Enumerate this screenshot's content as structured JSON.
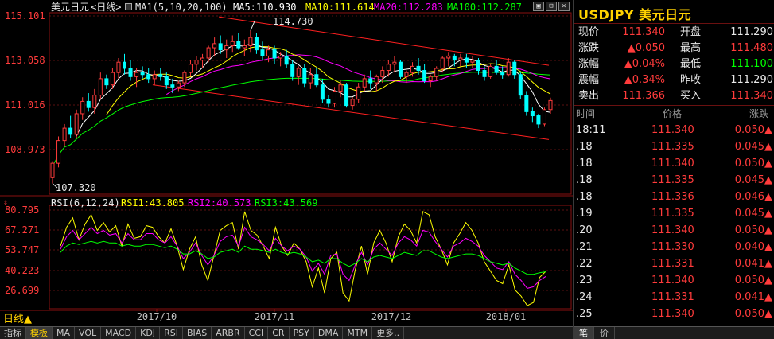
{
  "main_header": {
    "title": "美元日元",
    "period_tag": "<日线>",
    "ma_params": "MA1(5,10,20,100)",
    "ma5": "MA5:110.930",
    "ma10": "MA10:111.614",
    "ma20": "MA20:112.283",
    "ma100": "MA100:112.287"
  },
  "price_axis": {
    "ticks": [
      "115.101",
      "113.058",
      "111.016",
      "108.973"
    ]
  },
  "annotations": {
    "high": "114.730",
    "low": "107.320"
  },
  "rsi_header": {
    "params": "RSI(6,12,24)",
    "rsi1": "RSI1:43.805",
    "rsi2": "RSI2:40.573",
    "rsi3": "RSI3:43.569"
  },
  "rsi_axis": {
    "ticks": [
      "80.795",
      "67.271",
      "53.747",
      "40.223",
      "26.699"
    ]
  },
  "x_axis": {
    "labels": [
      "2017/10",
      "2017/11",
      "2017/12",
      "2018/01"
    ]
  },
  "period_label": "日线▲",
  "bottom_tabs": [
    "指标",
    "模板",
    "MA",
    "VOL",
    "MACD",
    "KDJ",
    "RSI",
    "BIAS",
    "ARBR",
    "CCI",
    "CR",
    "PSY",
    "DMA",
    "MTM",
    "更多.."
  ],
  "active_bottom_tab": "模板",
  "colors": {
    "up": "#ff3b3b",
    "down": "#00ffff",
    "ma5": "#ffffff",
    "ma10": "#ffff00",
    "ma20": "#ff00ff",
    "ma100": "#00ff00",
    "channel": "#ff2020"
  },
  "quote": {
    "symbol_title": "USDJPY 美元日元",
    "rows": [
      {
        "l1": "现价",
        "v1": "111.340",
        "c1": "red",
        "l2": "开盘",
        "v2": "111.290",
        "c2": "wht"
      },
      {
        "l1": "涨跌",
        "v1": "▲0.050",
        "c1": "red",
        "l2": "最高",
        "v2": "111.480",
        "c2": "red"
      },
      {
        "l1": "涨幅",
        "v1": "▲0.04%",
        "c1": "red",
        "l2": "最低",
        "v2": "111.100",
        "c2": "grn"
      },
      {
        "l1": "震幅",
        "v1": "▲0.34%",
        "c1": "red",
        "l2": "昨收",
        "v2": "111.290",
        "c2": "wht"
      },
      {
        "l1": "卖出",
        "v1": "111.366",
        "c1": "red",
        "l2": "买入",
        "v2": "111.340",
        "c2": "red"
      }
    ]
  },
  "trades": {
    "headers": [
      "时间",
      "价格",
      "涨跌"
    ],
    "rows": [
      {
        "time": "18:11",
        "price": "111.340",
        "change": "0.050▲"
      },
      {
        "time": ".18",
        "price": "111.335",
        "change": "0.045▲"
      },
      {
        "time": ".18",
        "price": "111.340",
        "change": "0.050▲"
      },
      {
        "time": ".18",
        "price": "111.335",
        "change": "0.045▲"
      },
      {
        "time": ".18",
        "price": "111.336",
        "change": "0.046▲"
      },
      {
        "time": ".19",
        "price": "111.335",
        "change": "0.045▲"
      },
      {
        "time": ".20",
        "price": "111.340",
        "change": "0.050▲"
      },
      {
        "time": ".21",
        "price": "111.330",
        "change": "0.040▲"
      },
      {
        "time": ".22",
        "price": "111.331",
        "change": "0.041▲"
      },
      {
        "time": ".23",
        "price": "111.340",
        "change": "0.050▲"
      },
      {
        "time": ".24",
        "price": "111.331",
        "change": "0.041▲"
      },
      {
        "time": ".25",
        "price": "111.340",
        "change": "0.050▲"
      }
    ]
  },
  "right_tabs": [
    "笔",
    "价"
  ],
  "active_right_tab": "笔",
  "chart_data": {
    "type": "candlestick",
    "title": "美元日元<日线>",
    "ylim": [
      106.8,
      115.6
    ],
    "x_labels": [
      "2017/10",
      "2017/11",
      "2017/12",
      "2018/01"
    ],
    "candles": [
      {
        "o": 107.6,
        "h": 108.4,
        "l": 107.32,
        "c": 108.3
      },
      {
        "o": 108.3,
        "h": 109.6,
        "l": 108.1,
        "c": 109.4
      },
      {
        "o": 109.4,
        "h": 110.2,
        "l": 109.1,
        "c": 110.0
      },
      {
        "o": 110.0,
        "h": 110.6,
        "l": 109.5,
        "c": 109.7
      },
      {
        "o": 109.7,
        "h": 110.9,
        "l": 109.5,
        "c": 110.7
      },
      {
        "o": 110.7,
        "h": 111.5,
        "l": 110.4,
        "c": 111.3
      },
      {
        "o": 111.3,
        "h": 111.7,
        "l": 110.8,
        "c": 111.0
      },
      {
        "o": 111.0,
        "h": 111.9,
        "l": 110.7,
        "c": 111.6
      },
      {
        "o": 111.6,
        "h": 112.7,
        "l": 111.4,
        "c": 112.4
      },
      {
        "o": 112.4,
        "h": 112.6,
        "l": 111.9,
        "c": 112.1
      },
      {
        "o": 112.1,
        "h": 112.9,
        "l": 111.9,
        "c": 112.7
      },
      {
        "o": 112.7,
        "h": 113.4,
        "l": 112.4,
        "c": 113.2
      },
      {
        "o": 113.2,
        "h": 113.6,
        "l": 112.6,
        "c": 112.9
      },
      {
        "o": 112.9,
        "h": 113.3,
        "l": 112.3,
        "c": 112.5
      },
      {
        "o": 112.5,
        "h": 112.9,
        "l": 112.0,
        "c": 112.7
      },
      {
        "o": 112.7,
        "h": 113.0,
        "l": 112.4,
        "c": 112.6
      },
      {
        "o": 112.6,
        "h": 112.9,
        "l": 112.2,
        "c": 112.4
      },
      {
        "o": 112.4,
        "h": 112.8,
        "l": 112.1,
        "c": 112.6
      },
      {
        "o": 112.6,
        "h": 112.9,
        "l": 112.3,
        "c": 112.5
      },
      {
        "o": 112.5,
        "h": 112.7,
        "l": 111.9,
        "c": 112.1
      },
      {
        "o": 112.1,
        "h": 112.4,
        "l": 111.7,
        "c": 112.0
      },
      {
        "o": 112.0,
        "h": 112.3,
        "l": 111.8,
        "c": 112.2
      },
      {
        "o": 112.2,
        "h": 112.8,
        "l": 112.0,
        "c": 112.7
      },
      {
        "o": 112.7,
        "h": 113.3,
        "l": 112.5,
        "c": 113.1
      },
      {
        "o": 113.1,
        "h": 113.5,
        "l": 112.8,
        "c": 113.3
      },
      {
        "o": 113.3,
        "h": 113.6,
        "l": 112.9,
        "c": 113.4
      },
      {
        "o": 113.4,
        "h": 114.0,
        "l": 113.2,
        "c": 113.9
      },
      {
        "o": 113.9,
        "h": 114.4,
        "l": 113.5,
        "c": 114.1
      },
      {
        "o": 114.1,
        "h": 114.5,
        "l": 113.6,
        "c": 113.8
      },
      {
        "o": 113.8,
        "h": 114.3,
        "l": 113.4,
        "c": 114.0
      },
      {
        "o": 114.0,
        "h": 114.5,
        "l": 113.7,
        "c": 114.2
      },
      {
        "o": 114.2,
        "h": 114.6,
        "l": 113.8,
        "c": 113.9
      },
      {
        "o": 113.9,
        "h": 114.3,
        "l": 113.5,
        "c": 114.0
      },
      {
        "o": 114.0,
        "h": 114.73,
        "l": 113.7,
        "c": 114.4
      },
      {
        "o": 114.4,
        "h": 114.6,
        "l": 113.6,
        "c": 113.8
      },
      {
        "o": 113.8,
        "h": 114.2,
        "l": 113.3,
        "c": 113.5
      },
      {
        "o": 113.5,
        "h": 114.0,
        "l": 113.2,
        "c": 113.8
      },
      {
        "o": 113.8,
        "h": 114.0,
        "l": 113.1,
        "c": 113.4
      },
      {
        "o": 113.4,
        "h": 113.7,
        "l": 113.0,
        "c": 113.5
      },
      {
        "o": 113.5,
        "h": 113.8,
        "l": 112.9,
        "c": 113.1
      },
      {
        "o": 113.1,
        "h": 113.3,
        "l": 112.3,
        "c": 112.5
      },
      {
        "o": 112.5,
        "h": 113.0,
        "l": 112.1,
        "c": 112.9
      },
      {
        "o": 112.9,
        "h": 113.1,
        "l": 112.0,
        "c": 112.2
      },
      {
        "o": 112.2,
        "h": 112.9,
        "l": 111.9,
        "c": 112.6
      },
      {
        "o": 112.6,
        "h": 112.9,
        "l": 112.0,
        "c": 112.1
      },
      {
        "o": 112.1,
        "h": 112.4,
        "l": 111.2,
        "c": 111.4
      },
      {
        "o": 111.4,
        "h": 111.6,
        "l": 111.0,
        "c": 111.2
      },
      {
        "o": 111.2,
        "h": 112.0,
        "l": 111.0,
        "c": 111.8
      },
      {
        "o": 111.8,
        "h": 112.3,
        "l": 111.5,
        "c": 112.1
      },
      {
        "o": 112.1,
        "h": 112.2,
        "l": 111.0,
        "c": 111.1
      },
      {
        "o": 111.1,
        "h": 111.5,
        "l": 110.9,
        "c": 111.4
      },
      {
        "o": 111.4,
        "h": 112.2,
        "l": 111.2,
        "c": 112.0
      },
      {
        "o": 112.0,
        "h": 112.6,
        "l": 111.8,
        "c": 112.4
      },
      {
        "o": 112.4,
        "h": 112.8,
        "l": 111.9,
        "c": 112.2
      },
      {
        "o": 112.2,
        "h": 112.6,
        "l": 111.8,
        "c": 112.5
      },
      {
        "o": 112.5,
        "h": 113.0,
        "l": 112.2,
        "c": 112.8
      },
      {
        "o": 112.8,
        "h": 113.3,
        "l": 112.5,
        "c": 113.1
      },
      {
        "o": 113.1,
        "h": 113.5,
        "l": 112.7,
        "c": 113.2
      },
      {
        "o": 113.2,
        "h": 113.3,
        "l": 112.4,
        "c": 112.5
      },
      {
        "o": 112.5,
        "h": 112.8,
        "l": 112.2,
        "c": 112.7
      },
      {
        "o": 112.7,
        "h": 113.2,
        "l": 112.5,
        "c": 113.0
      },
      {
        "o": 113.0,
        "h": 113.4,
        "l": 112.6,
        "c": 112.8
      },
      {
        "o": 112.8,
        "h": 113.1,
        "l": 112.2,
        "c": 112.3
      },
      {
        "o": 112.3,
        "h": 112.6,
        "l": 112.0,
        "c": 112.5
      },
      {
        "o": 112.5,
        "h": 113.0,
        "l": 112.3,
        "c": 112.9
      },
      {
        "o": 112.9,
        "h": 113.5,
        "l": 112.7,
        "c": 113.4
      },
      {
        "o": 113.4,
        "h": 113.7,
        "l": 113.0,
        "c": 113.5
      },
      {
        "o": 113.5,
        "h": 113.6,
        "l": 113.0,
        "c": 113.3
      },
      {
        "o": 113.3,
        "h": 113.6,
        "l": 113.0,
        "c": 113.4
      },
      {
        "o": 113.4,
        "h": 113.6,
        "l": 112.9,
        "c": 113.2
      },
      {
        "o": 113.2,
        "h": 113.5,
        "l": 112.9,
        "c": 113.3
      },
      {
        "o": 113.3,
        "h": 113.4,
        "l": 112.6,
        "c": 112.8
      },
      {
        "o": 112.8,
        "h": 113.0,
        "l": 112.3,
        "c": 112.5
      },
      {
        "o": 112.5,
        "h": 113.1,
        "l": 112.4,
        "c": 113.0
      },
      {
        "o": 113.0,
        "h": 113.3,
        "l": 112.6,
        "c": 112.7
      },
      {
        "o": 112.7,
        "h": 113.0,
        "l": 112.4,
        "c": 112.6
      },
      {
        "o": 112.6,
        "h": 113.4,
        "l": 112.5,
        "c": 113.2
      },
      {
        "o": 113.2,
        "h": 113.3,
        "l": 112.4,
        "c": 112.6
      },
      {
        "o": 112.6,
        "h": 112.7,
        "l": 111.4,
        "c": 111.6
      },
      {
        "o": 111.6,
        "h": 111.8,
        "l": 110.6,
        "c": 110.8
      },
      {
        "o": 110.8,
        "h": 111.0,
        "l": 110.3,
        "c": 110.6
      },
      {
        "o": 110.6,
        "h": 110.7,
        "l": 110.0,
        "c": 110.2
      },
      {
        "o": 110.2,
        "h": 111.0,
        "l": 110.1,
        "c": 110.9
      },
      {
        "o": 110.9,
        "h": 111.48,
        "l": 110.7,
        "c": 111.34
      }
    ],
    "rsi_ylim": [
      20,
      86
    ],
    "rsi_series": [
      {
        "name": "RSI1",
        "color": "#ffff00",
        "values": [
          60,
          72,
          78,
          64,
          74,
          80,
          70,
          75,
          69,
          73,
          60,
          74,
          65,
          66,
          73,
          72,
          66,
          62,
          71,
          60,
          45,
          58,
          66,
          48,
          38,
          54,
          70,
          73,
          75,
          58,
          82,
          70,
          67,
          60,
          52,
          72,
          60,
          54,
          62,
          58,
          50,
          34,
          46,
          30,
          52,
          56,
          30,
          25,
          45,
          60,
          42,
          62,
          70,
          62,
          50,
          66,
          74,
          70,
          62,
          82,
          80,
          66,
          58,
          48,
          62,
          68,
          75,
          70,
          62,
          50,
          44,
          38,
          36,
          48,
          32,
          28,
          22,
          24,
          40,
          43.8
        ]
      },
      {
        "name": "RSI2",
        "color": "#ff00ff",
        "values": [
          58,
          66,
          70,
          64,
          68,
          72,
          68,
          70,
          67,
          68,
          62,
          68,
          64,
          64,
          68,
          68,
          64,
          62,
          66,
          60,
          52,
          56,
          62,
          54,
          48,
          54,
          63,
          66,
          67,
          60,
          72,
          66,
          64,
          61,
          57,
          65,
          60,
          57,
          60,
          58,
          53,
          44,
          49,
          42,
          54,
          55,
          42,
          38,
          48,
          56,
          48,
          58,
          62,
          58,
          54,
          62,
          66,
          64,
          60,
          70,
          69,
          63,
          58,
          53,
          60,
          62,
          65,
          63,
          60,
          54,
          50,
          46,
          45,
          50,
          42,
          38,
          33,
          34,
          38,
          40.6
        ]
      },
      {
        "name": "RSI3",
        "color": "#00ff00",
        "values": [
          56,
          60,
          62,
          61,
          62,
          63,
          62,
          63,
          62,
          62,
          60,
          61,
          60,
          60,
          61,
          61,
          60,
          59,
          60,
          58,
          55,
          55,
          57,
          55,
          52,
          53,
          56,
          57,
          58,
          56,
          60,
          58,
          58,
          57,
          56,
          58,
          56,
          55,
          56,
          55,
          53,
          50,
          51,
          49,
          52,
          52,
          49,
          47,
          49,
          52,
          50,
          53,
          54,
          53,
          52,
          54,
          56,
          55,
          54,
          57,
          57,
          55,
          53,
          52,
          53,
          54,
          55,
          55,
          54,
          52,
          50,
          49,
          48,
          49,
          46,
          44,
          42,
          42,
          43,
          43.6
        ]
      }
    ]
  }
}
